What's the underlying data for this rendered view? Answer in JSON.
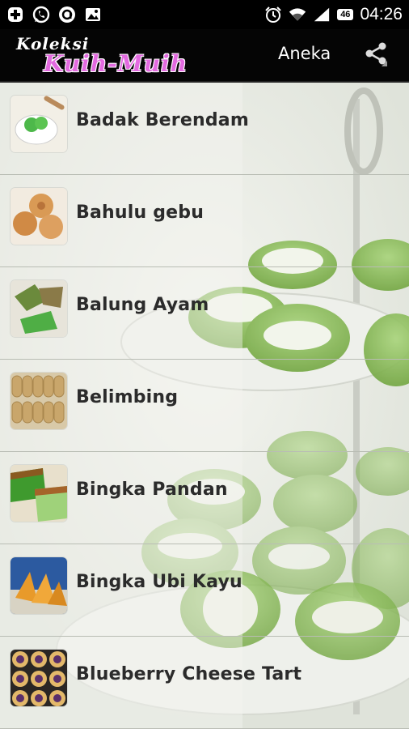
{
  "status_bar": {
    "time": "04:26",
    "battery": "46",
    "left_icons": [
      "plus-icon",
      "whatsapp-icon",
      "messaging-app-icon",
      "image-icon"
    ],
    "right_icons": [
      "alarm-icon",
      "wifi-icon",
      "signal-icon"
    ]
  },
  "action_bar": {
    "logo_top": "Koleksi",
    "logo_bottom": "Kuih-Muih",
    "title": "Aneka",
    "share_icon": "share-icon"
  },
  "items": [
    {
      "label": "Badak Berendam"
    },
    {
      "label": "Bahulu gebu"
    },
    {
      "label": "Balung Ayam"
    },
    {
      "label": "Belimbing"
    },
    {
      "label": "Bingka Pandan"
    },
    {
      "label": "Bingka Ubi Kayu"
    },
    {
      "label": "Blueberry Cheese Tart"
    }
  ],
  "colors": {
    "bar": "#000000",
    "accent": "#e36ae0",
    "kuih_green": "#8fc45c"
  }
}
